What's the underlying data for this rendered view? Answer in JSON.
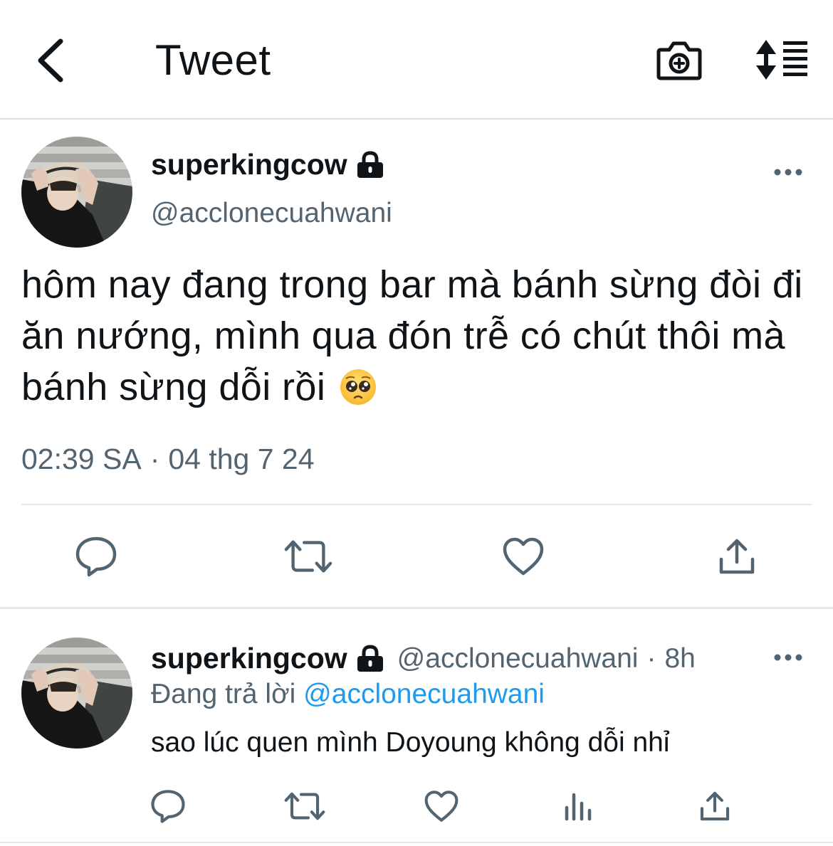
{
  "header": {
    "title": "Tweet",
    "back_icon": "chevron-left-icon",
    "camera_icon": "camera-plus-icon",
    "sort_icon": "sort-list-icon"
  },
  "tweet": {
    "display_name": "superkingcow",
    "handle": "@acclonecuahwani",
    "protected_icon": "lock-icon",
    "text": "hôm nay đang trong bar mà bánh sừng đòi đi ăn nướng, mình qua đón trễ có chút thôi mà bánh sừng dỗi rồi",
    "emoji": "pleading-face",
    "time": "02:39 SA",
    "separator": "·",
    "date": "04 thg 7 24",
    "actions": [
      "reply-icon",
      "retweet-icon",
      "like-icon",
      "share-icon"
    ]
  },
  "reply": {
    "display_name": "superkingcow",
    "handle": "@acclonecuahwani",
    "separator": "·",
    "age": "8h",
    "replying_prefix": "Đang trả lời",
    "replying_to": "@acclonecuahwani",
    "text": "sao lúc quen mình Doyoung không dỗi nhỉ",
    "actions": [
      "reply-icon",
      "retweet-icon",
      "like-icon",
      "views-icon",
      "share-icon"
    ]
  },
  "colors": {
    "text_primary": "#0f1419",
    "text_secondary": "#536471",
    "link": "#1d9bf0",
    "icon": "#536471",
    "divider": "#e6e8ea"
  }
}
